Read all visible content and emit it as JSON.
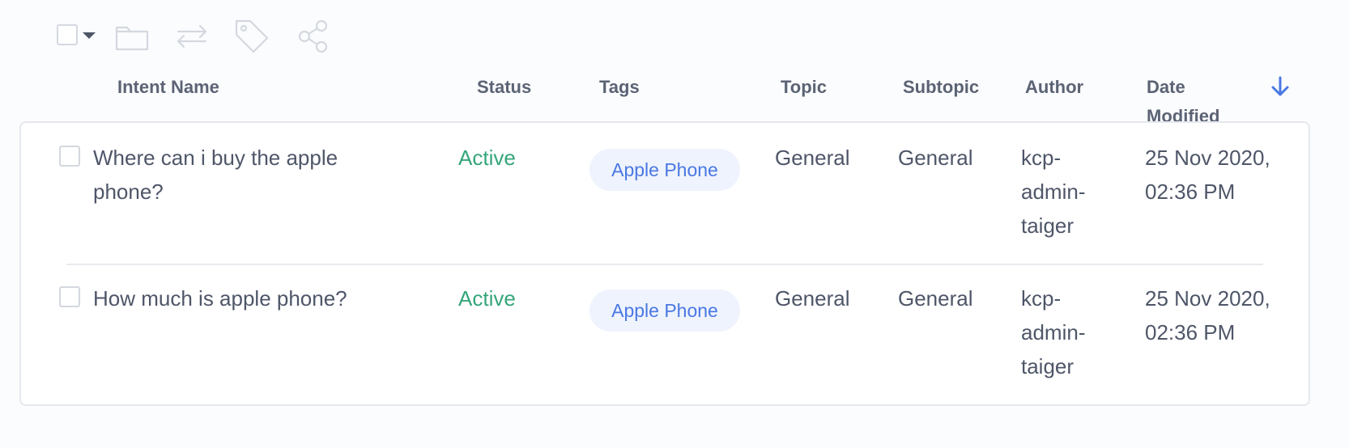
{
  "toolbar": {
    "icons": [
      "checkbox-select-all",
      "chevron-down-icon",
      "folder-icon",
      "transfer-icon",
      "tag-icon",
      "share-icon"
    ]
  },
  "columns": {
    "intent_name": "Intent Name",
    "status": "Status",
    "tags": "Tags",
    "topic": "Topic",
    "subtopic": "Subtopic",
    "author": "Author",
    "date_modified_line1": "Date",
    "date_modified_line2": "Modified",
    "sort_icon": "arrow-down-icon"
  },
  "rows": [
    {
      "intent_line1": "Where can i buy the apple",
      "intent_line2": "phone?",
      "status": "Active",
      "tag": "Apple Phone",
      "topic": "General",
      "subtopic": "General",
      "author_line1": "kcp-",
      "author_line2": "admin-",
      "author_line3": "taiger",
      "date_line1": "25 Nov 2020,",
      "date_line2": "02:36 PM"
    },
    {
      "intent_line1": "How much is apple phone?",
      "intent_line2": "",
      "status": "Active",
      "tag": "Apple Phone",
      "topic": "General",
      "subtopic": "General",
      "author_line1": "kcp-",
      "author_line2": "admin-",
      "author_line3": "taiger",
      "date_line1": "25 Nov 2020,",
      "date_line2": "02:36 PM"
    }
  ],
  "colors": {
    "status_active": "#35a67a",
    "tag_text": "#4a78e3",
    "tag_bg": "#eef3fd",
    "sort_arrow": "#4a78e3"
  }
}
